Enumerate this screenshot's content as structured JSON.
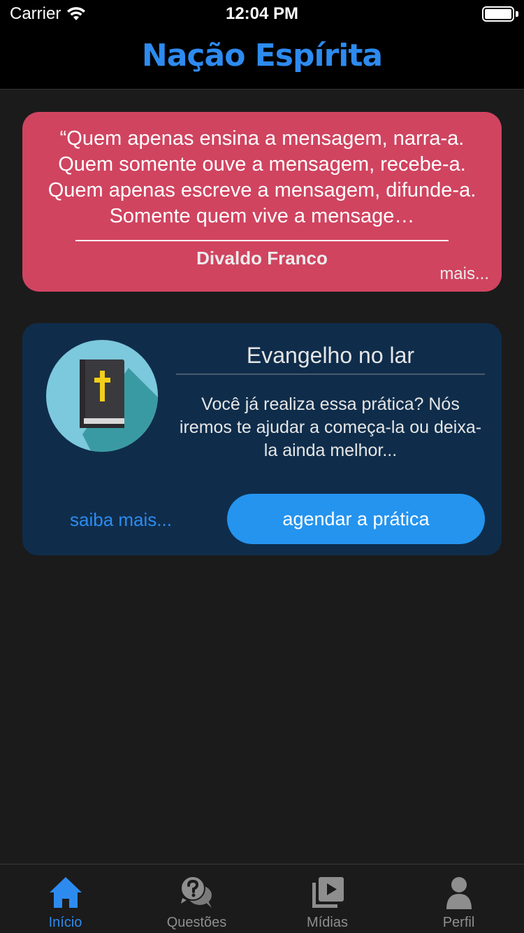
{
  "status_bar": {
    "carrier": "Carrier",
    "time": "12:04 PM"
  },
  "nav": {
    "title": "Nação Espírita"
  },
  "quote_card": {
    "text": "“Quem apenas ensina a mensagem, narra-a. Quem somente ouve a mensagem, recebe-a. Quem apenas escreve a mensagem, difunde-a. Somente quem vive a mensage…",
    "author": "Divaldo Franco",
    "more_label": "mais...",
    "color": "#d04460"
  },
  "gospel_card": {
    "icon": "bible-icon",
    "title": "Evangelho no lar",
    "description": "Você já realiza essa prática? Nós iremos te ajudar a começa-la ou deixa-la ainda melhor...",
    "learn_more_label": "saiba mais...",
    "schedule_label": "agendar a prática",
    "color": "#0f2d4b",
    "button_color": "#2494ef"
  },
  "tabs": [
    {
      "label": "Início",
      "icon": "home-icon",
      "active": true
    },
    {
      "label": "Questões",
      "icon": "questions-icon",
      "active": false
    },
    {
      "label": "Mídias",
      "icon": "media-icon",
      "active": false
    },
    {
      "label": "Perfil",
      "icon": "profile-icon",
      "active": false
    }
  ],
  "accent_color": "#2d8bf0"
}
